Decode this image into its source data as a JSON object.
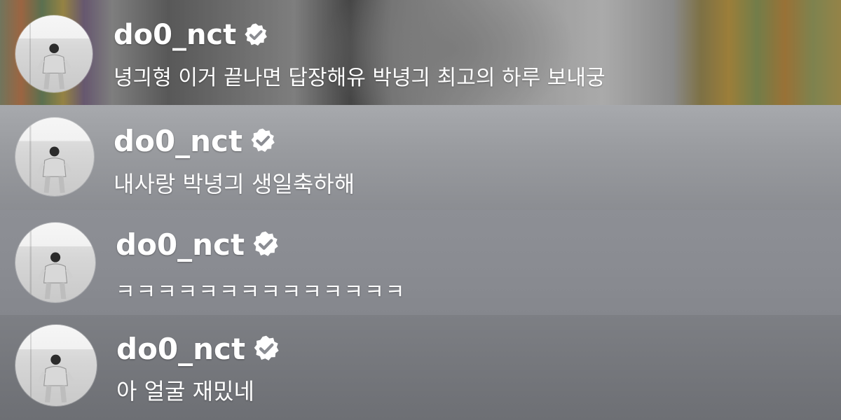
{
  "comments": [
    {
      "username": "do0_nct",
      "verified": true,
      "message": "녕긔형 이거 끝나면 답장해유 박녕긔 최고의 하루 보내궁",
      "avatar_icon": "profile-photo",
      "badge_icon": "verified-badge-icon"
    },
    {
      "username": "do0_nct",
      "verified": true,
      "message": "내사랑 박녕긔 생일축하해",
      "avatar_icon": "profile-photo",
      "badge_icon": "verified-badge-icon"
    },
    {
      "username": "do0_nct",
      "verified": true,
      "message": "ㅋㅋㅋㅋㅋㅋㅋㅋㅋㅋㅋㅋㅋㅋ",
      "avatar_icon": "profile-photo",
      "badge_icon": "verified-badge-icon"
    },
    {
      "username": "do0_nct",
      "verified": true,
      "message": "아 얼굴 재밌네",
      "avatar_icon": "profile-photo",
      "badge_icon": "verified-badge-icon"
    }
  ],
  "colors": {
    "text": "#ffffff",
    "badge_fill": "#ffffff",
    "badge_check": "#8a8c92"
  }
}
